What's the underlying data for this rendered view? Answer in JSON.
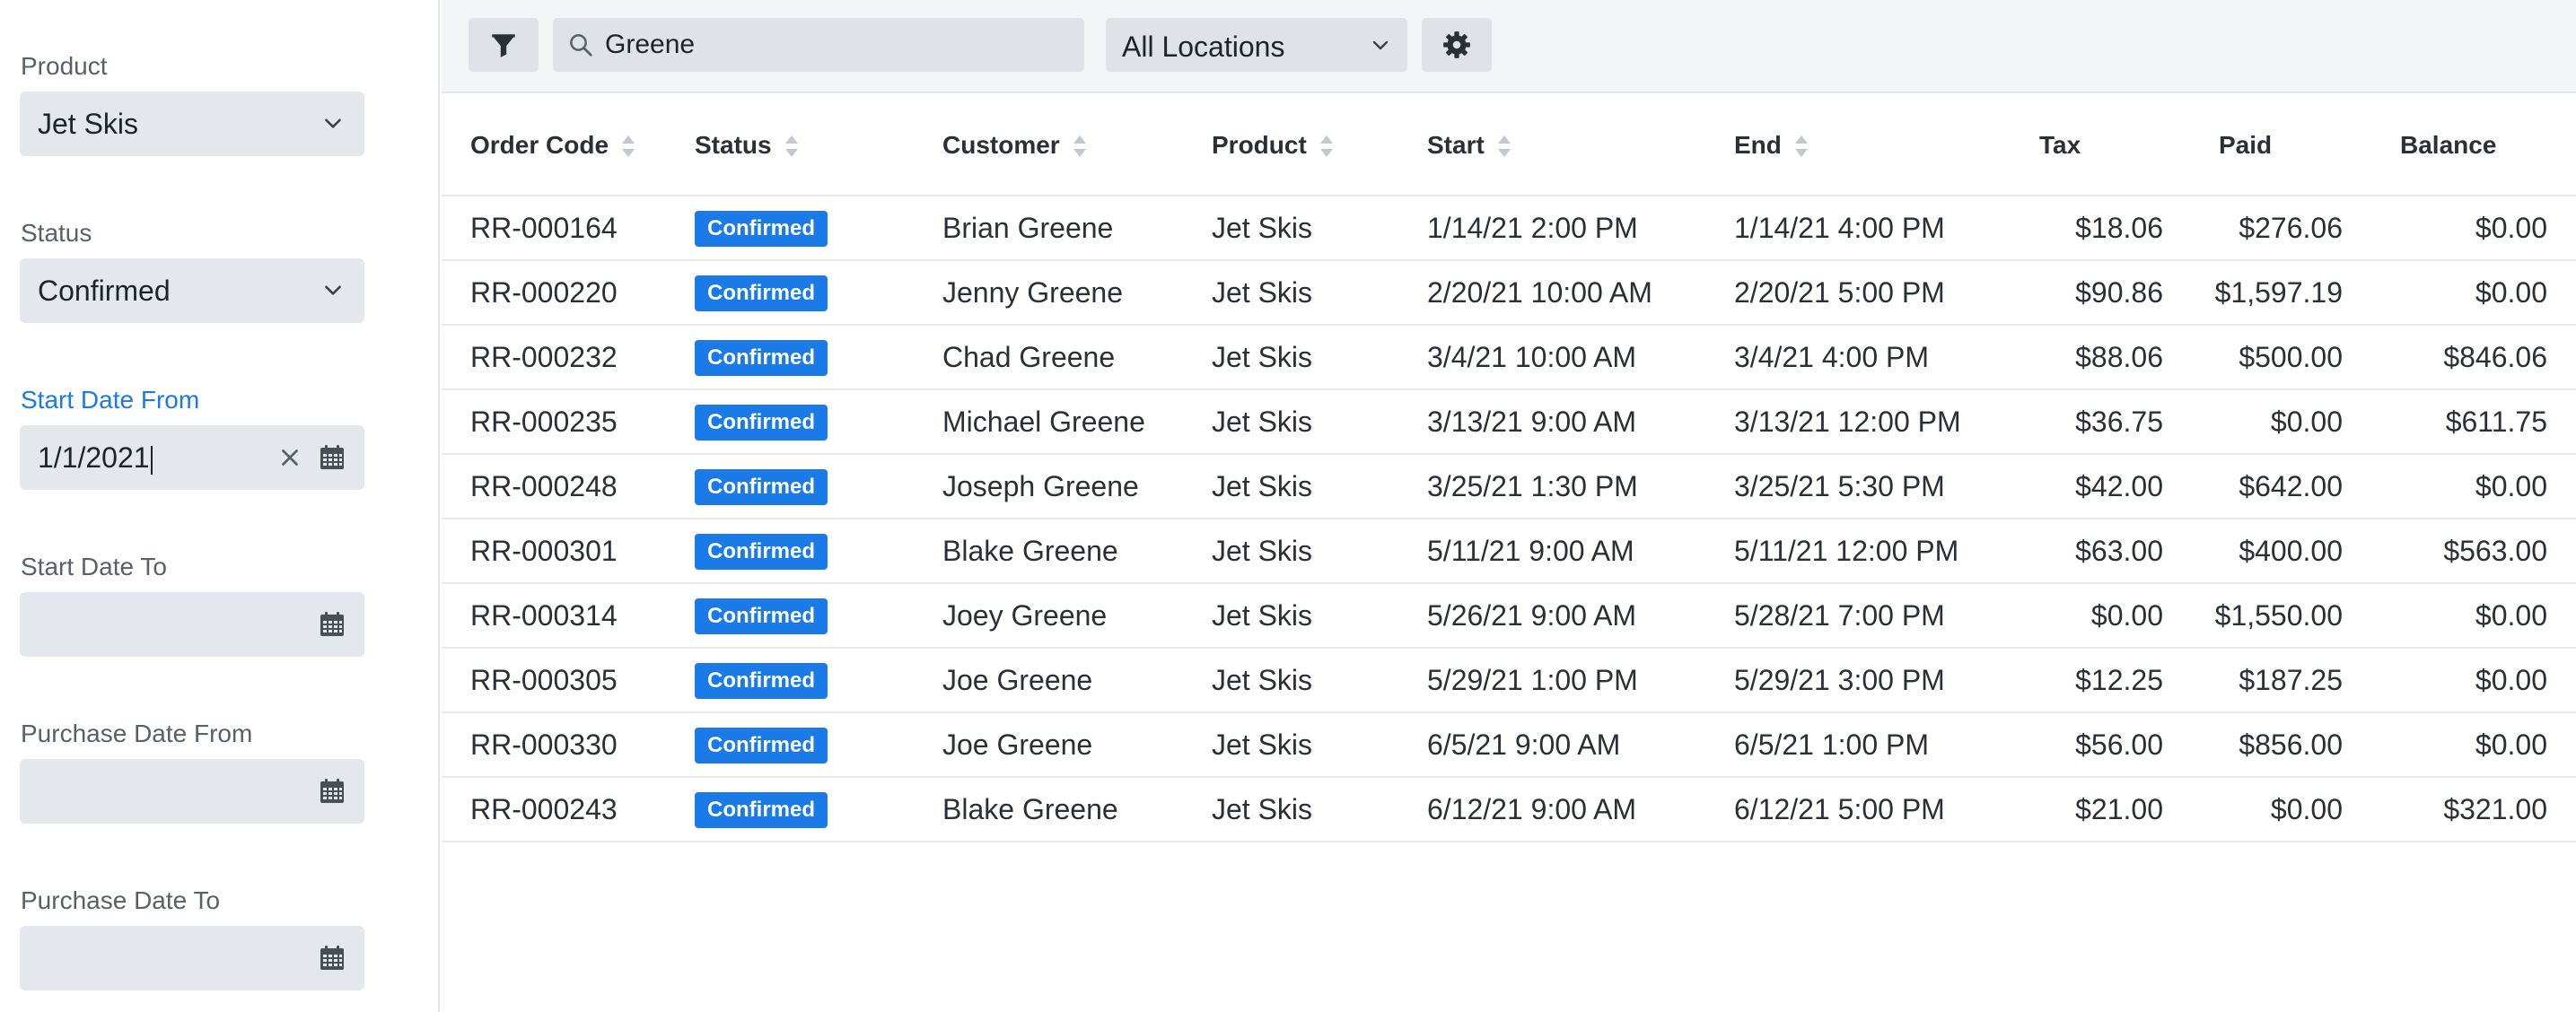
{
  "sidebar": {
    "product": {
      "label": "Product",
      "value": "Jet Skis"
    },
    "status": {
      "label": "Status",
      "value": "Confirmed"
    },
    "start_from": {
      "label": "Start Date From",
      "value": "1/1/2021"
    },
    "start_to": {
      "label": "Start Date To",
      "value": ""
    },
    "purchase_from": {
      "label": "Purchase Date From",
      "value": ""
    },
    "purchase_to": {
      "label": "Purchase Date To",
      "value": ""
    }
  },
  "toolbar": {
    "search_value": "Greene",
    "location": "All Locations"
  },
  "colors": {
    "accent": "#1a7ae8",
    "badge": "#1a7ae8"
  },
  "table": {
    "headers": [
      "Order Code",
      "Status",
      "Customer",
      "Product",
      "Start",
      "End",
      "Tax",
      "Paid",
      "Balance"
    ],
    "rows": [
      [
        "RR-000164",
        "Confirmed",
        "Brian Greene",
        "Jet Skis",
        "1/14/21 2:00 PM",
        "1/14/21 4:00 PM",
        "$18.06",
        "$276.06",
        "$0.00"
      ],
      [
        "RR-000220",
        "Confirmed",
        "Jenny Greene",
        "Jet Skis",
        "2/20/21 10:00 AM",
        "2/20/21 5:00 PM",
        "$90.86",
        "$1,597.19",
        "$0.00"
      ],
      [
        "RR-000232",
        "Confirmed",
        "Chad Greene",
        "Jet Skis",
        "3/4/21 10:00 AM",
        "3/4/21 4:00 PM",
        "$88.06",
        "$500.00",
        "$846.06"
      ],
      [
        "RR-000235",
        "Confirmed",
        "Michael Greene",
        "Jet Skis",
        "3/13/21 9:00 AM",
        "3/13/21 12:00 PM",
        "$36.75",
        "$0.00",
        "$611.75"
      ],
      [
        "RR-000248",
        "Confirmed",
        "Joseph Greene",
        "Jet Skis",
        "3/25/21 1:30 PM",
        "3/25/21 5:30 PM",
        "$42.00",
        "$642.00",
        "$0.00"
      ],
      [
        "RR-000301",
        "Confirmed",
        "Blake Greene",
        "Jet Skis",
        "5/11/21 9:00 AM",
        "5/11/21 12:00 PM",
        "$63.00",
        "$400.00",
        "$563.00"
      ],
      [
        "RR-000314",
        "Confirmed",
        "Joey Greene",
        "Jet Skis",
        "5/26/21 9:00 AM",
        "5/28/21 7:00 PM",
        "$0.00",
        "$1,550.00",
        "$0.00"
      ],
      [
        "RR-000305",
        "Confirmed",
        "Joe Greene",
        "Jet Skis",
        "5/29/21 1:00 PM",
        "5/29/21 3:00 PM",
        "$12.25",
        "$187.25",
        "$0.00"
      ],
      [
        "RR-000330",
        "Confirmed",
        "Joe Greene",
        "Jet Skis",
        "6/5/21 9:00 AM",
        "6/5/21 1:00 PM",
        "$56.00",
        "$856.00",
        "$0.00"
      ],
      [
        "RR-000243",
        "Confirmed",
        "Blake Greene",
        "Jet Skis",
        "6/12/21 9:00 AM",
        "6/12/21 5:00 PM",
        "$21.00",
        "$0.00",
        "$321.00"
      ]
    ]
  }
}
